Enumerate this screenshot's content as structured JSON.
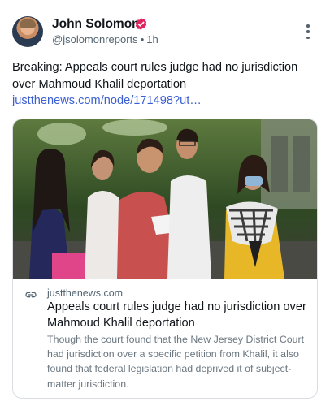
{
  "post": {
    "author": {
      "name": "John Solomon",
      "handle": "@jsolomonreports",
      "separator": "•",
      "time": "1h",
      "verified_icon": "verified-badge-icon",
      "verified_color": "#e0245e"
    },
    "more_icon": "vertical-ellipsis-icon",
    "text": "Breaking: Appeals court rules judge had no jurisdiction over Mahmoud Khalil deportation ",
    "text_link": "justthenews.com/node/171498?ut…",
    "link_color": "#3b5fd4",
    "card": {
      "image_icon": "news-photo",
      "link_icon": "chain-link-icon",
      "domain": "justthenews.com",
      "title": "Appeals court rules judge had no jurisdiction over Mahmoud Khalil deportation",
      "description": "Though the court found that the New Jersey District Court had jurisdiction over a specific petition from Khalil, it also found that federal legislation had deprived it of subject-matter jurisdiction."
    }
  }
}
